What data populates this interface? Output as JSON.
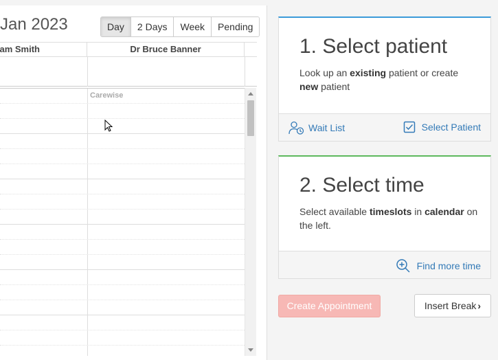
{
  "calendar": {
    "title": "Jan 2023",
    "views": [
      "Day",
      "2 Days",
      "Week",
      "Pending"
    ],
    "active_view": "Day",
    "doctors": [
      "Dr Adam Smith",
      "Dr Bruce Banner"
    ],
    "doctor1_visible": "am Smith",
    "slot_label": "Carewise"
  },
  "select_patient": {
    "title": "1. Select patient",
    "desc_pre": "Look up an ",
    "desc_b1": "existing",
    "desc_mid": " patient or create ",
    "desc_b2": "new",
    "desc_post": " patient",
    "wait_list": "Wait List",
    "select_patient": "Select Patient"
  },
  "select_time": {
    "title": "2. Select time",
    "desc_pre": "Select available ",
    "desc_b1": "timeslots",
    "desc_mid": " in ",
    "desc_b2": "calendar",
    "desc_post": " on the left.",
    "find_more": "Find more time"
  },
  "actions": {
    "create": "Create Appointment",
    "insert_break": "Insert Break",
    "insert_break_chevron": "›"
  },
  "colors": {
    "accent_blue": "#3a9ad9",
    "accent_green": "#5cb85c",
    "link": "#337ab7",
    "create_disabled": "#f7b8b5"
  }
}
